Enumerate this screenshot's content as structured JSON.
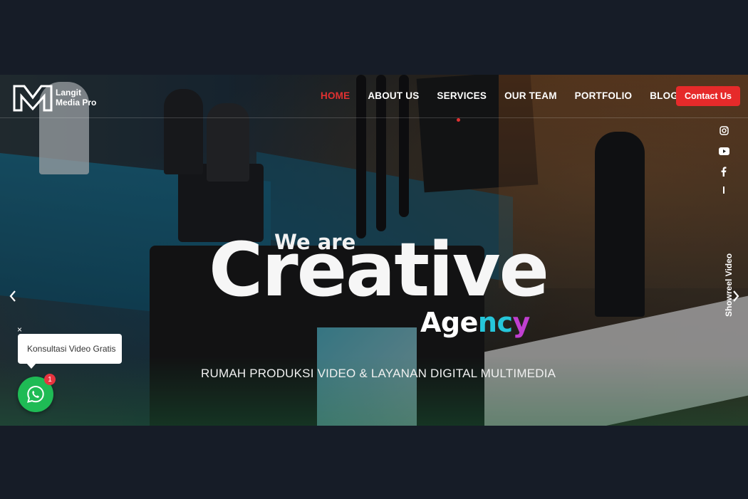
{
  "brand": {
    "name_line1": "Langit",
    "name_line2": "Media Pro"
  },
  "nav": {
    "items": [
      {
        "label": "HOME",
        "active": true
      },
      {
        "label": "ABOUT US",
        "active": false
      },
      {
        "label": "SERVICES",
        "active": false
      },
      {
        "label": "OUR TEAM",
        "active": false
      },
      {
        "label": "PORTFOLIO",
        "active": false
      },
      {
        "label": "BLOG",
        "active": false
      }
    ],
    "contact_label": "Contact Us"
  },
  "hero": {
    "we_are": "We are",
    "headline": "Creative",
    "agency_part1": "Age",
    "agency_part2": "nc",
    "agency_part3": "y",
    "tagline": "RUMAH PRODUKSI VIDEO & LAYANAN DIGITAL MULTIMEDIA"
  },
  "social": {
    "icons": [
      "instagram-icon",
      "youtube-icon",
      "facebook-icon"
    ],
    "showreel_label": "Showreel Video"
  },
  "whatsapp": {
    "bubble_text": "Konsultasi Video Gratis",
    "close_symbol": "×",
    "badge_count": "1"
  },
  "colors": {
    "accent_red": "#e62a2a",
    "agency_cyan": "#26c6da",
    "agency_purple": "#c03fd0",
    "whatsapp_green": "#1fbb55",
    "page_bg": "#161c27"
  }
}
